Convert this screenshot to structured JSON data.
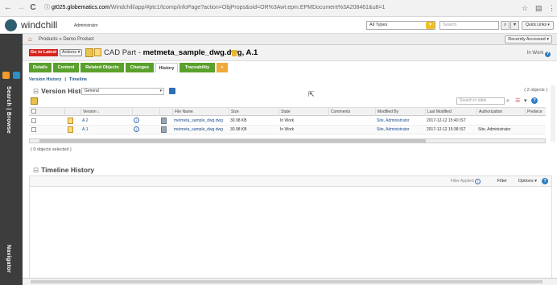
{
  "browser": {
    "back": "←",
    "forward": "→",
    "reload": "C",
    "secure": "ⓘ",
    "url_host": "gt025.globematics.com",
    "url_path": "/Windchill/app/#ptc1/tcomp/infoPage?action=ObjProps&oid=OR%3Awt.epm.EPMDocument%3A208461&u8=1",
    "star": "☆",
    "ext": "▤",
    "menu": "⋮"
  },
  "header": {
    "brand": "windchill",
    "user": "Administrator",
    "type_filter": "All Types",
    "search_placeholder": "Search",
    "search_btn": "⌕",
    "search_opt": "▾",
    "quick_links": "Quick Links ▾"
  },
  "sidebar": {
    "search_browse": "Search | Browse",
    "navigator": "Navigator"
  },
  "breadcrumb": {
    "home": "⌂",
    "path": "Products » Demo Product",
    "recent": "Recently Accessed ▾"
  },
  "object": {
    "go_latest": "Go to Latest",
    "actions": "Actions ▾",
    "type_label": "CAD Part -",
    "name": "metmeta_sample_dwg.dwg, A.1",
    "state": "In Work"
  },
  "tabs": [
    {
      "label": "Details"
    },
    {
      "label": "Content"
    },
    {
      "label": "Related Objects"
    },
    {
      "label": "Changes"
    },
    {
      "label": "History"
    },
    {
      "label": "Traceability"
    },
    {
      "label": "+"
    }
  ],
  "subnav": {
    "version_history": "Version History",
    "sep": "|",
    "timeline": "Timeline"
  },
  "version_history": {
    "collapse": "⊟",
    "title": "Version History",
    "view": "General",
    "view_arrow": "▾",
    "count": "( 2 objects )",
    "filter_placeholder": "Search in table",
    "icons": {
      "find": "⌕",
      "list": "☰",
      "more": "▾",
      "help": "?"
    },
    "columns": [
      {
        "label": "",
        "key": "select"
      },
      {
        "label": "",
        "key": "type"
      },
      {
        "label": "Version ↓",
        "key": "version"
      },
      {
        "label": "",
        "key": "info"
      },
      {
        "label": "",
        "key": "file"
      },
      {
        "label": "File Name",
        "key": "file_name"
      },
      {
        "label": "Size",
        "key": "size"
      },
      {
        "label": "State",
        "key": "state"
      },
      {
        "label": "Comments",
        "key": "comments"
      },
      {
        "label": "Modified By",
        "key": "modified_by"
      },
      {
        "label": "Last Modified",
        "key": "last_modified"
      },
      {
        "label": "Authorization",
        "key": "authorization"
      },
      {
        "label": "Predece",
        "key": "pred"
      }
    ],
    "rows": [
      {
        "version": "A.2",
        "file_name": "metmeta_sample_dwg.dwg",
        "size": "30.98 KB",
        "state": "In Work",
        "comments": "",
        "modified_by": "Site, Administrator",
        "last_modified": "2017-12-12 15:40 IST",
        "authorization": "",
        "pred": ""
      },
      {
        "version": "A.1",
        "file_name": "metmeta_sample_dwg.dwg",
        "size": "30.98 KB",
        "state": "In Work",
        "comments": "",
        "modified_by": "Site, Administrator",
        "last_modified": "2017-12-12 15:38 IST",
        "authorization": "Site, Administrator",
        "pred": ""
      }
    ],
    "selected": "( 0 objects selected )"
  },
  "timeline": {
    "collapse": "⊟",
    "title": "Timeline History",
    "filter_applied": "Filter Applied",
    "filter": "Filter",
    "options": "Options ▾",
    "help": "?"
  },
  "info_glyph": "i",
  "colors": {
    "tab_green": "#5aa02c",
    "go_latest_red": "#d7241e",
    "sidebar": "#3d3d3d"
  }
}
